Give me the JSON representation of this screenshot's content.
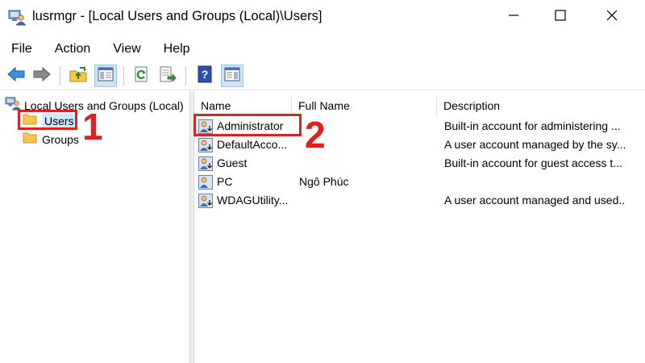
{
  "window": {
    "title": "lusrmgr - [Local Users and Groups (Local)\\Users]",
    "app_icon": "computer-users-icon"
  },
  "window_controls": {
    "minimize_icon": "minimize-icon",
    "maximize_icon": "maximize-icon",
    "close_icon": "close-icon"
  },
  "menu": {
    "items": [
      "File",
      "Action",
      "View",
      "Help"
    ]
  },
  "toolbar": {
    "buttons": [
      "back-arrow-icon",
      "forward-arrow-icon",
      "up-folder-icon",
      "show-hide-tree-icon",
      "refresh-icon",
      "export-list-icon",
      "help-icon",
      "show-hide-action-pane-icon"
    ]
  },
  "tree": {
    "root_label": "Local Users and Groups (Local)",
    "nodes": [
      {
        "label": "Users",
        "selected": true
      },
      {
        "label": "Groups",
        "selected": false
      }
    ]
  },
  "list": {
    "columns": [
      "Name",
      "Full Name",
      "Description"
    ],
    "rows": [
      {
        "name": "Administrator",
        "full_name": "",
        "description": "Built-in account for administering ..."
      },
      {
        "name": "DefaultAcco...",
        "full_name": "",
        "description": "A user account managed by the sy..."
      },
      {
        "name": "Guest",
        "full_name": "",
        "description": "Built-in account for guest access t..."
      },
      {
        "name": "PC",
        "full_name": "Ngô Phúc",
        "description": ""
      },
      {
        "name": "WDAGUtility...",
        "full_name": "",
        "description": "A user account managed and used..."
      }
    ]
  },
  "annotations": {
    "step1": "1",
    "step2": "2",
    "color": "#e02020"
  },
  "colors": {
    "selection": "#cce8ff",
    "toolbar_active": "#cce4f7",
    "folder": "#f5c64a"
  }
}
